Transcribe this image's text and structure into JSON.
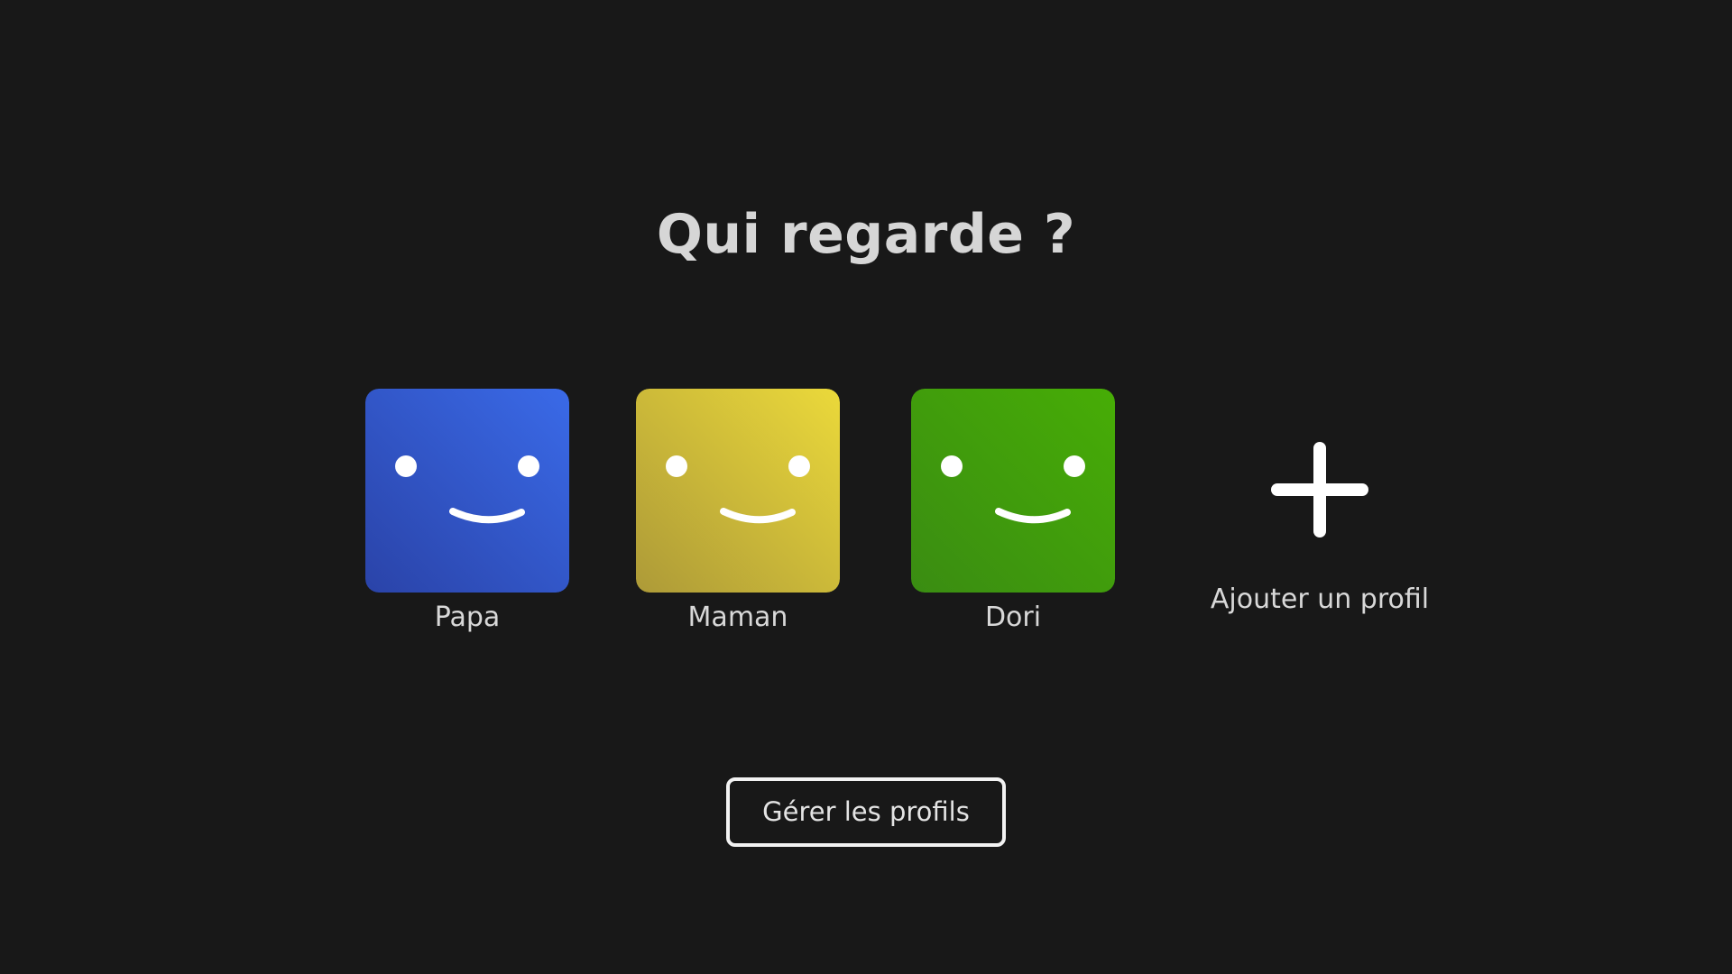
{
  "header": {
    "title": "Qui regarde ?"
  },
  "profiles": [
    {
      "name": "Papa",
      "avatar_icon": "smiley-face-icon",
      "color_top": "#3a66e6",
      "color_bottom": "#2a45ad"
    },
    {
      "name": "Maman",
      "avatar_icon": "smiley-face-icon",
      "color_top": "#e8d73c",
      "color_bottom": "#b09c37"
    },
    {
      "name": "Dori",
      "avatar_icon": "smiley-face-icon",
      "color_top": "#45ab07",
      "color_bottom": "#3a8e10"
    }
  ],
  "add_profile": {
    "label": "Ajouter un profil",
    "icon": "plus-icon"
  },
  "manage": {
    "label": "Gérer les profils"
  },
  "theme": {
    "background": "#181818",
    "text": "#d6d6d6"
  }
}
